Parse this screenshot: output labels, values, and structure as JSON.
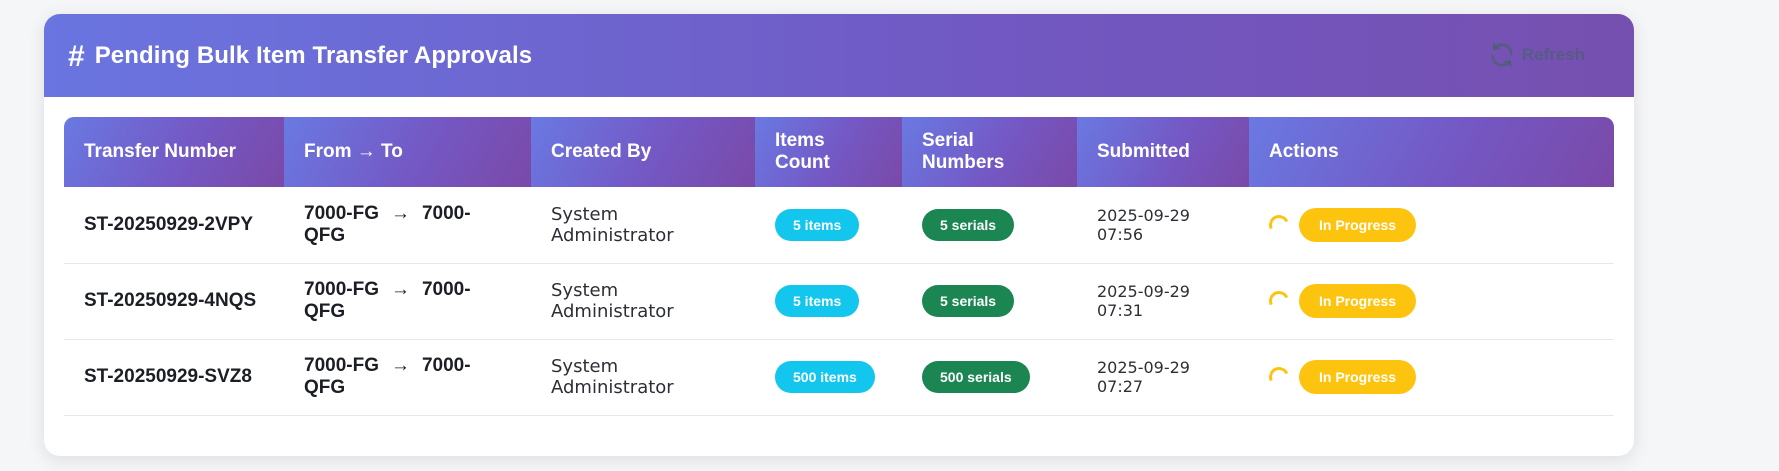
{
  "header": {
    "title": "Pending Bulk Item Transfer Approvals",
    "hash_icon": "#",
    "refresh_label": "Refresh"
  },
  "table": {
    "columns": [
      "Transfer Number",
      "From → To",
      "Created By",
      "Items Count",
      "Serial Numbers",
      "Submitted",
      "Actions"
    ],
    "rows": [
      {
        "transfer_number": "ST-20250929-2VPY",
        "from": "7000-FG",
        "to": "7000-QFG",
        "created_by": "System Administrator",
        "items": "5 items",
        "serials": "5 serials",
        "submitted": "2025-09-29 07:56",
        "status": "In Progress"
      },
      {
        "transfer_number": "ST-20250929-4NQS",
        "from": "7000-FG",
        "to": "7000-QFG",
        "created_by": "System Administrator",
        "items": "5 items",
        "serials": "5 serials",
        "submitted": "2025-09-29 07:31",
        "status": "In Progress"
      },
      {
        "transfer_number": "ST-20250929-SVZ8",
        "from": "7000-FG",
        "to": "7000-QFG",
        "created_by": "System Administrator",
        "items": "500 items",
        "serials": "500 serials",
        "submitted": "2025-09-29 07:27",
        "status": "In Progress"
      }
    ]
  },
  "colors": {
    "header_gradient_start": "#6a75e0",
    "header_gradient_end": "#7650b0",
    "items_badge": "#12c6ee",
    "serials_badge": "#1b8652",
    "status_badge": "#fdc40f"
  }
}
